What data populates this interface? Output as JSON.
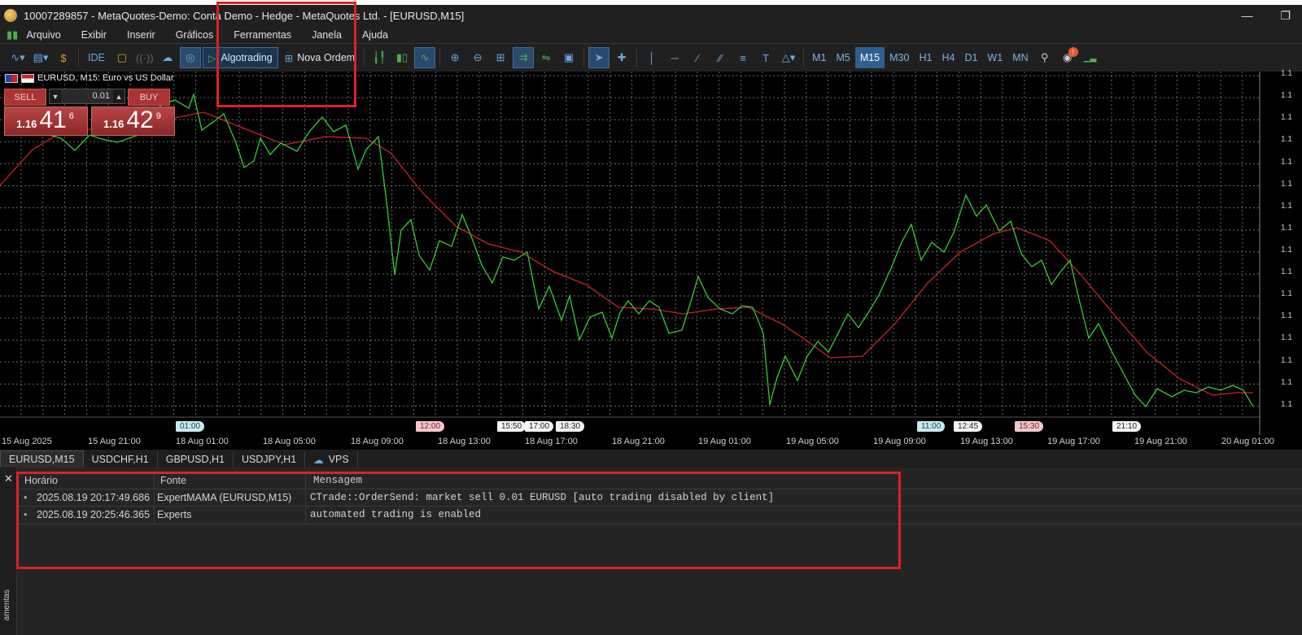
{
  "window": {
    "title": "10007289857 - MetaQuotes-Demo: Conta Demo - Hedge - MetaQuotes Ltd. - [EURUSD,M15]"
  },
  "menu": [
    "Arquivo",
    "Exibir",
    "Inserir",
    "Gráficos",
    "Ferramentas",
    "Janela",
    "Ajuda"
  ],
  "toolbar": {
    "ide_label": "IDE",
    "algotrading_label": "Algotrading",
    "new_order_label": "Nova Ordem",
    "timeframes": [
      "M1",
      "M5",
      "M15",
      "M30",
      "H1",
      "H4",
      "D1",
      "W1",
      "MN"
    ],
    "active_timeframe": "M15",
    "notification_badge": "!"
  },
  "chart": {
    "symbol_label": "EURUSD, M15:  Euro vs US Dollar",
    "one_click": {
      "sell_label": "SELL",
      "buy_label": "BUY",
      "lot": "0.01",
      "sell_small": "1.16",
      "sell_big": "41",
      "sell_sup": "6",
      "buy_small": "1.16",
      "buy_big": "42",
      "buy_sup": "9"
    },
    "price_axis_label": "1.1",
    "time_labels": [
      "15 Aug 2025",
      "15 Aug 21:00",
      "18 Aug 01:00",
      "18 Aug 05:00",
      "18 Aug 09:00",
      "18 Aug 13:00",
      "18 Aug 17:00",
      "18 Aug 21:00",
      "19 Aug 01:00",
      "19 Aug 05:00",
      "19 Aug 09:00",
      "19 Aug 13:00",
      "19 Aug 17:00",
      "19 Aug 21:00",
      "20 Aug 01:00"
    ],
    "event_markers": [
      {
        "label": "01:00",
        "kind": "cyan"
      },
      {
        "label": "12:00",
        "kind": "red"
      },
      {
        "label": "15:50",
        "kind": "white"
      },
      {
        "label": "17:00",
        "kind": "white"
      },
      {
        "label": "18:30",
        "kind": "white"
      },
      {
        "label": "11:00",
        "kind": "cyan"
      },
      {
        "label": "12:45",
        "kind": "white"
      },
      {
        "label": "15:30",
        "kind": "red"
      },
      {
        "label": "21:10",
        "kind": "white"
      }
    ],
    "colors": {
      "price_line": "#33cc33",
      "ma_line": "#cc2222",
      "background": "#000000",
      "grid": "#6a6a6a"
    }
  },
  "chart_tabs": [
    "EURUSD,M15",
    "USDCHF,H1",
    "GBPUSD,H1",
    "USDJPY,H1",
    "VPS"
  ],
  "toolbox": {
    "side_label": "amentas",
    "columns": [
      "Horário",
      "Fonte",
      "Mensagem"
    ],
    "rows": [
      {
        "time": "2025.08.19 20:17:49.686",
        "source": "ExpertMAMA (EURUSD,M15)",
        "message": "CTrade::OrderSend: market sell 0.01 EURUSD [auto trading disabled by client]"
      },
      {
        "time": "2025.08.19 20:25:46.365",
        "source": "Experts",
        "message": "automated trading is enabled"
      }
    ]
  }
}
